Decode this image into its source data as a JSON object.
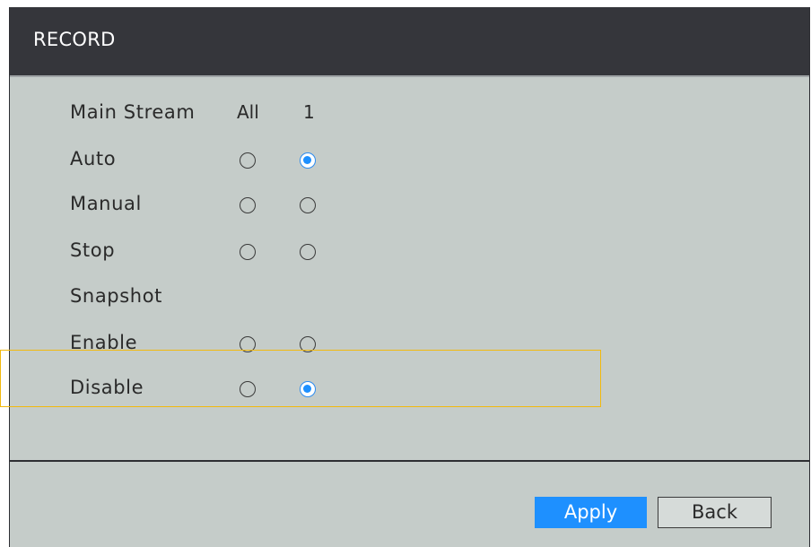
{
  "window": {
    "title": "RECORD"
  },
  "main_stream": {
    "label": "Main Stream",
    "col_all": "All",
    "col_1": "1"
  },
  "modes": [
    {
      "label": "Auto",
      "all_checked": false,
      "ch1_checked": true
    },
    {
      "label": "Manual",
      "all_checked": false,
      "ch1_checked": false
    },
    {
      "label": "Stop",
      "all_checked": false,
      "ch1_checked": false
    }
  ],
  "snapshot": {
    "label": "Snapshot",
    "options": [
      {
        "label": "Enable",
        "all_checked": false,
        "ch1_checked": false
      },
      {
        "label": "Disable",
        "all_checked": false,
        "ch1_checked": true
      }
    ]
  },
  "footer": {
    "apply_label": "Apply",
    "back_label": "Back"
  },
  "colors": {
    "accent": "#1e90ff",
    "highlight_border": "#f2b90d",
    "titlebar": "#35363b",
    "panel": "#c5ccc9"
  }
}
